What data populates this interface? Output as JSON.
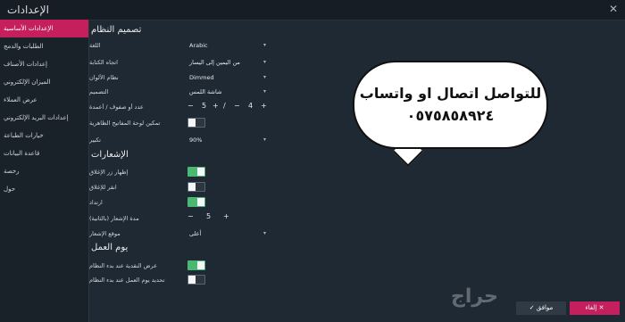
{
  "window": {
    "title": "الإعدادات",
    "close_glyph": "✕"
  },
  "sidebar": {
    "items": [
      {
        "label": "الإعدادات الأساسية"
      },
      {
        "label": "الطلبات والدمج"
      },
      {
        "label": "إعدادات الأصناف"
      },
      {
        "label": "الميزان الإلكتروني"
      },
      {
        "label": "عرض العملاء"
      },
      {
        "label": "إعدادات البريد الإلكتروني"
      },
      {
        "label": "خيارات الطباعة"
      },
      {
        "label": "قاعدة البيانات"
      },
      {
        "label": "رخصة"
      },
      {
        "label": "حول"
      }
    ]
  },
  "system_design": {
    "title": "تصميم النظام",
    "language": {
      "label": "اللغة",
      "value": "Arabic"
    },
    "writing_direction": {
      "label": "اتجاه الكتابة",
      "value": "من اليمين إلى اليسار"
    },
    "color_system": {
      "label": "نظام الألوان",
      "value": "Dimmed"
    },
    "design": {
      "label": "التصميم",
      "value": "شاشة اللمس"
    },
    "rows_columns": {
      "label": "عدد أو صفوف / أعمدة",
      "minus1": "−",
      "val1": "5",
      "plus1": "+",
      "slash": "/",
      "minus2": "−",
      "val2": "4",
      "plus2": "+"
    },
    "virtual_keyboard": {
      "label": "تمكين لوحة المفاتيح الظاهرية"
    },
    "zoom": {
      "label": "تكبير",
      "value": "90%"
    }
  },
  "notifications": {
    "title": "الإشعارات",
    "show_close": {
      "label": "إظهار زر الإغلاق"
    },
    "close_notification": {
      "label": "انقر للإغلاق"
    },
    "sound": {
      "label": "ارتداد"
    },
    "duration": {
      "label": "مدة الإشعار (بالثانية)",
      "minus": "−",
      "value": "5",
      "plus": "+"
    },
    "position": {
      "label": "موقع الإشعار",
      "value": "أعلى"
    }
  },
  "work_day": {
    "title": "يوم العمل",
    "show_cash": {
      "label": "عرض النقدية عند بدء النظام"
    },
    "set_work_day": {
      "label": "تحديد يوم العمل عند بدء النظام"
    }
  },
  "promo": {
    "line1": "للتواصل اتصال او واتساب",
    "line2": "٠٥٧٥٨٥٨٩٢٤"
  },
  "watermark": {
    "text": "حراج"
  },
  "footer": {
    "ok": "✓ موافق",
    "cancel": "إلغاء ✕"
  },
  "state": {
    "virtual_keyboard_on": false,
    "show_close_on": true,
    "close_notification_on": false,
    "sound_on": true,
    "show_cash_on": true,
    "set_work_day_on": false
  }
}
